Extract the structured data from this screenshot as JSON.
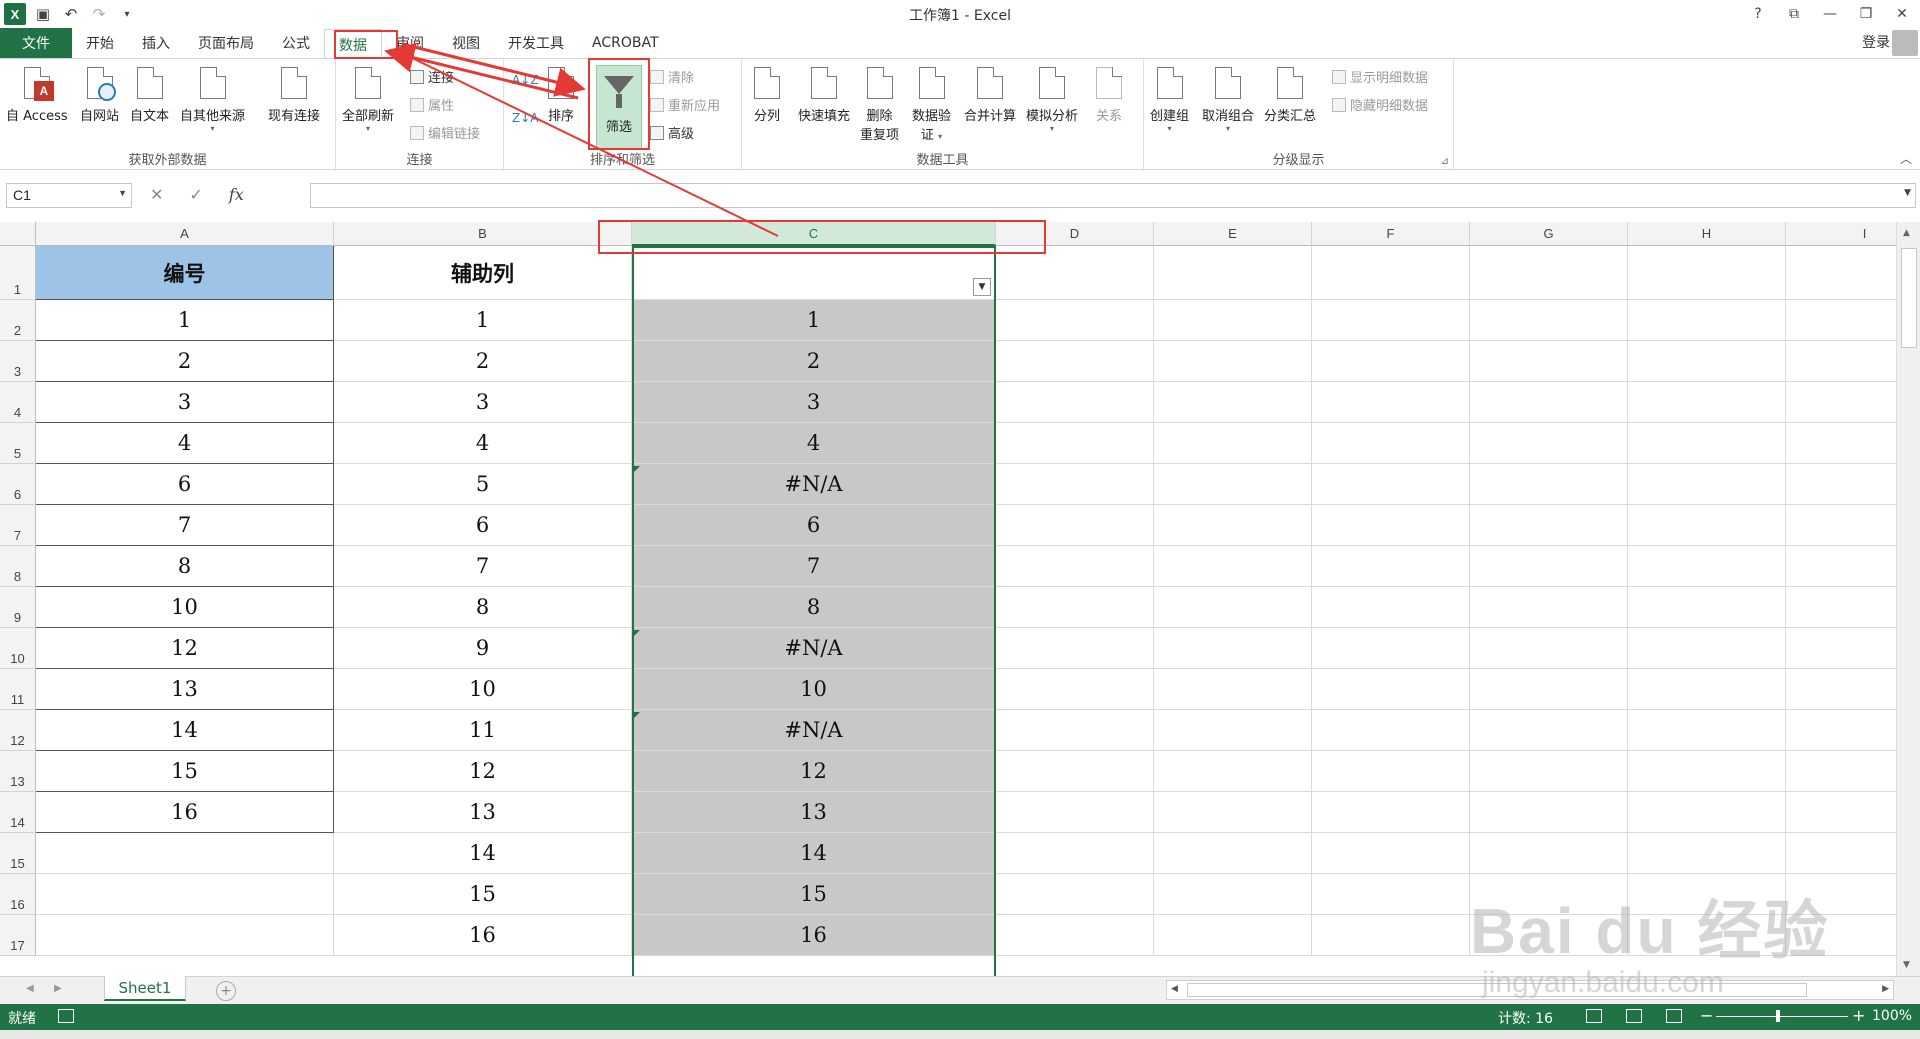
{
  "window": {
    "title": "工作簿1 - Excel",
    "logo_letter": "X",
    "controls": [
      "?",
      "⧉",
      "—",
      "❐",
      "✕"
    ]
  },
  "tabs": {
    "file": "文件",
    "items": [
      "开始",
      "插入",
      "页面布局",
      "公式",
      "数据",
      "审阅",
      "视图",
      "开发工具",
      "ACROBAT"
    ],
    "active": "数据",
    "login": "登录"
  },
  "ribbon": {
    "groups": {
      "external": "获取外部数据",
      "connections": "连接",
      "sort_filter": "排序和筛选",
      "data_tools": "数据工具",
      "outline": "分级显示"
    },
    "buttons": {
      "from_access": "自 Access",
      "from_web": "自网站",
      "from_text": "自文本",
      "from_other": "自其他来源",
      "existing_conn": "现有连接",
      "refresh_all": "全部刷新",
      "connections": "连接",
      "properties": "属性",
      "edit_links": "编辑链接",
      "sort": "排序",
      "filter": "筛选",
      "clear": "清除",
      "reapply": "重新应用",
      "advanced": "高级",
      "text_to_columns": "分列",
      "flash_fill": "快速填充",
      "remove_dup_1": "删除",
      "remove_dup_2": "重复项",
      "validation_1": "数据验",
      "validation_2": "证",
      "consolidate": "合并计算",
      "whatif": "模拟分析",
      "relationships": "关系",
      "group": "创建组",
      "ungroup": "取消组合",
      "subtotal": "分类汇总",
      "show_detail": "显示明细数据",
      "hide_detail": "隐藏明细数据"
    }
  },
  "formula_bar": {
    "name_box": "C1",
    "cancel": "✕",
    "enter": "✓",
    "fx": "fx",
    "formula": ""
  },
  "sheet": {
    "columns": [
      "A",
      "B",
      "C",
      "D",
      "E",
      "F",
      "G",
      "H",
      "I"
    ],
    "rows": [
      "1",
      "2",
      "3",
      "4",
      "5",
      "6",
      "7",
      "8",
      "9",
      "10",
      "11",
      "12",
      "13",
      "14",
      "15",
      "16",
      "17"
    ],
    "col_a": [
      "编号",
      "1",
      "2",
      "3",
      "4",
      "6",
      "7",
      "8",
      "10",
      "12",
      "13",
      "14",
      "15",
      "16"
    ],
    "col_b": [
      "辅助列",
      "1",
      "2",
      "3",
      "4",
      "5",
      "6",
      "7",
      "8",
      "9",
      "10",
      "11",
      "12",
      "13",
      "14",
      "15",
      "16"
    ],
    "col_c": [
      "",
      "1",
      "2",
      "3",
      "4",
      "#N/A",
      "6",
      "7",
      "8",
      "#N/A",
      "10",
      "#N/A",
      "12",
      "13",
      "14",
      "15",
      "16"
    ],
    "header_fill": "#9dc3e6",
    "selection_fill": "#c8c8c8"
  },
  "sheet_tabs": {
    "active": "Sheet1",
    "add": "+"
  },
  "status": {
    "ready": "就绪",
    "count": "计数: 16",
    "zoom": "100%",
    "zoom_minus": "−",
    "zoom_plus": "+"
  },
  "watermark": {
    "main": "Bai du 经验",
    "sub": "jingyan.baidu.com"
  },
  "annotation_color": "#e53935"
}
